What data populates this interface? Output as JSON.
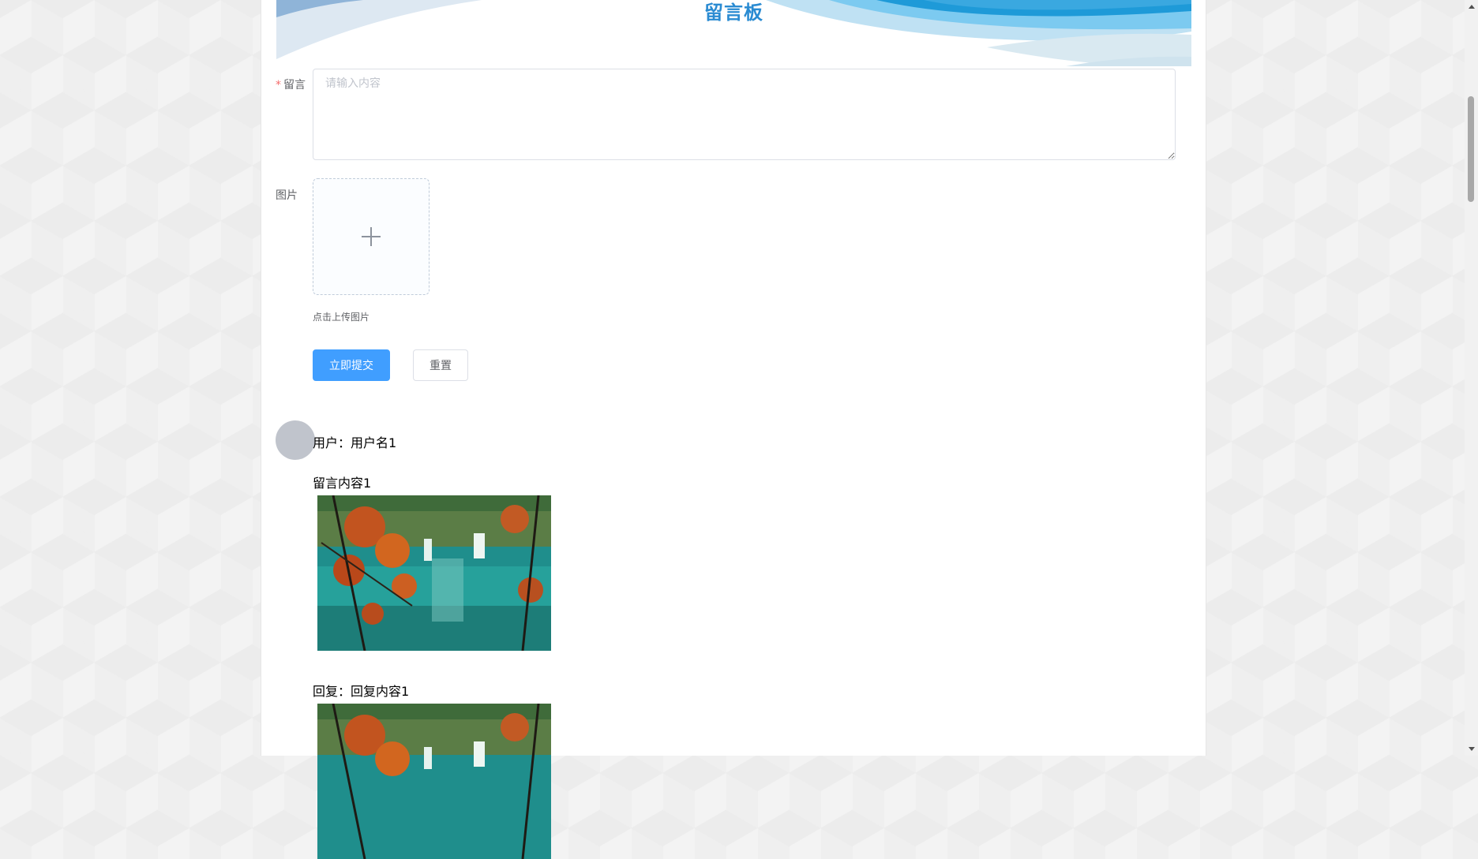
{
  "banner": {
    "title": "留言板"
  },
  "form": {
    "message_label": "留言",
    "required_mark": "*",
    "message_placeholder": "请输入内容",
    "message_value": "",
    "image_label": "图片",
    "upload_tip": "点击上传图片",
    "submit_label": "立即提交",
    "reset_label": "重置",
    "upload_icon": "plus-icon"
  },
  "messages": [
    {
      "user_line": "用户：用户名1",
      "content": "留言内容1",
      "reply_line": "回复：回复内容1"
    }
  ],
  "colors": {
    "accent": "#409eff",
    "title": "#2a8bd2",
    "avatar": "#c0c4cc",
    "required": "#f56c6c"
  },
  "scrollbar": {
    "up_icon": "triangle-up-icon",
    "down_icon": "triangle-down-icon"
  }
}
